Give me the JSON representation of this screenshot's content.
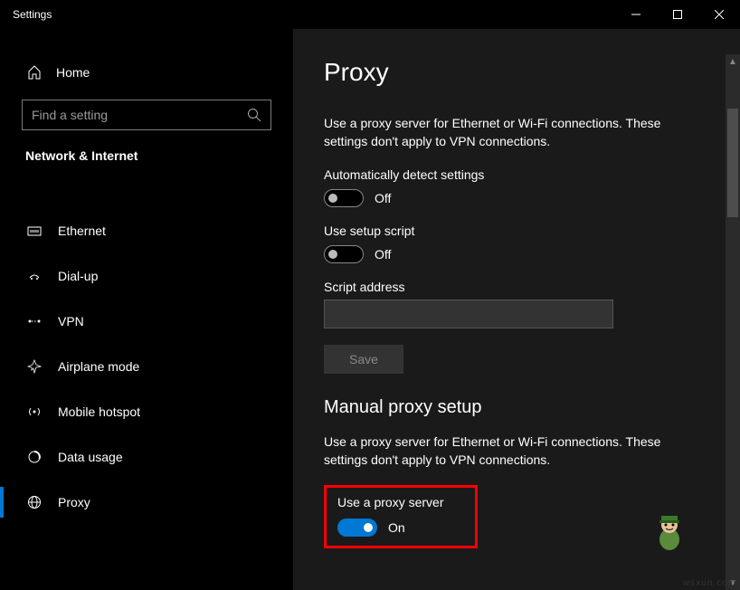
{
  "window": {
    "title": "Settings"
  },
  "sidebar": {
    "home_label": "Home",
    "search_placeholder": "Find a setting",
    "section_header": "Network & Internet",
    "items": [
      {
        "label": "Ethernet"
      },
      {
        "label": "Dial-up"
      },
      {
        "label": "VPN"
      },
      {
        "label": "Airplane mode"
      },
      {
        "label": "Mobile hotspot"
      },
      {
        "label": "Data usage"
      },
      {
        "label": "Proxy"
      }
    ]
  },
  "page": {
    "title": "Proxy",
    "auto_desc": "Use a proxy server for Ethernet or Wi-Fi connections. These settings don't apply to VPN connections.",
    "auto_detect_label": "Automatically detect settings",
    "auto_detect_state": "Off",
    "use_script_label": "Use setup script",
    "use_script_state": "Off",
    "script_address_label": "Script address",
    "save_label": "Save",
    "manual_title": "Manual proxy setup",
    "manual_desc": "Use a proxy server for Ethernet or Wi-Fi connections. These settings don't apply to VPN connections.",
    "use_proxy_label": "Use a proxy server",
    "use_proxy_state": "On"
  },
  "watermark": "wsxun.com"
}
